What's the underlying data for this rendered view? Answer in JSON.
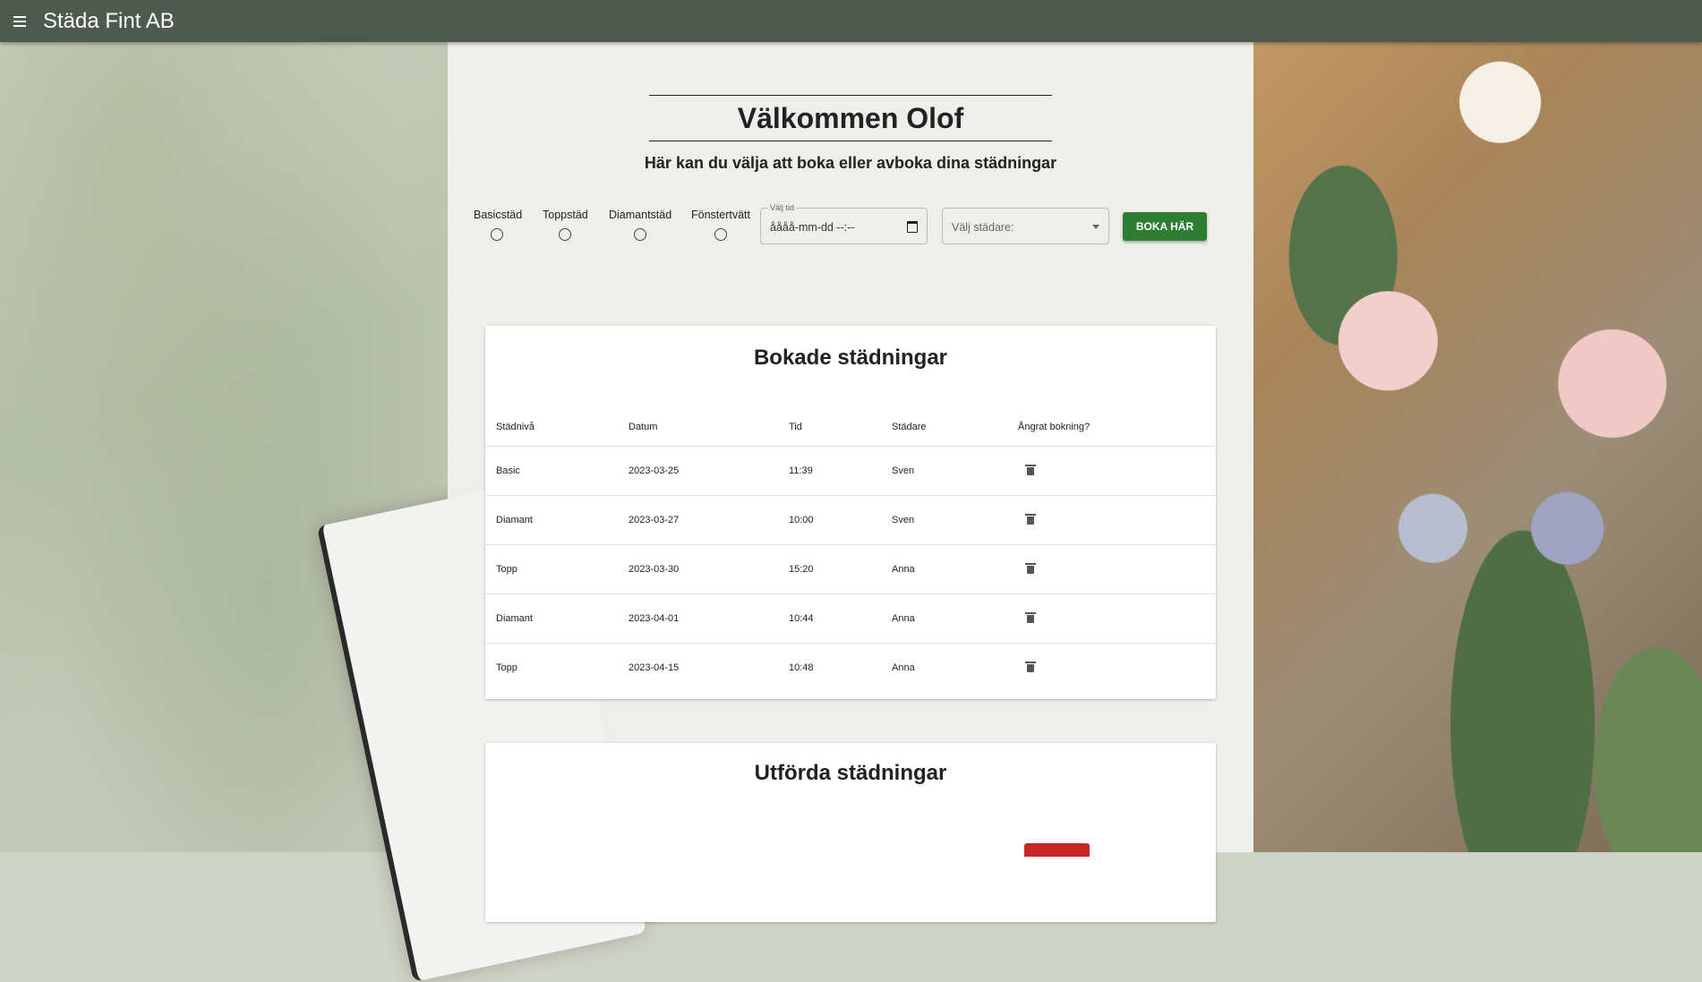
{
  "app": {
    "title": "Städa Fint AB"
  },
  "header": {
    "welcome": "Välkommen Olof",
    "subtitle": "Här kan du välja att boka eller avboka dina städningar"
  },
  "booking_form": {
    "options": [
      {
        "label": "Basicstäd"
      },
      {
        "label": "Toppstäd"
      },
      {
        "label": "Diamantstäd"
      },
      {
        "label": "Fönstertvätt"
      }
    ],
    "time_label": "Välj tid",
    "time_value": "åååå-mm-dd --:--",
    "cleaner_placeholder": "Välj städare:",
    "book_button": "BOKA HÄR"
  },
  "booked": {
    "title": "Bokade städningar",
    "columns": [
      "Städnivå",
      "Datum",
      "Tid",
      "Städare",
      "Ångrat bokning?"
    ],
    "rows": [
      {
        "level": "Basic",
        "date": "2023-03-25",
        "time": "11:39",
        "cleaner": "Sven"
      },
      {
        "level": "Diamant",
        "date": "2023-03-27",
        "time": "10:00",
        "cleaner": "Sven"
      },
      {
        "level": "Topp",
        "date": "2023-03-30",
        "time": "15:20",
        "cleaner": "Anna"
      },
      {
        "level": "Diamant",
        "date": "2023-04-01",
        "time": "10:44",
        "cleaner": "Anna"
      },
      {
        "level": "Topp",
        "date": "2023-04-15",
        "time": "10:48",
        "cleaner": "Anna"
      }
    ]
  },
  "completed": {
    "title": "Utförda städningar"
  },
  "icons": {
    "menu": "menu-icon",
    "calendar": "calendar-icon",
    "dropdown": "chevron-down-icon",
    "delete": "trash-icon"
  },
  "colors": {
    "topbar": "#4e5a4e",
    "primary_button": "#2e7d32",
    "danger": "#c62828"
  }
}
